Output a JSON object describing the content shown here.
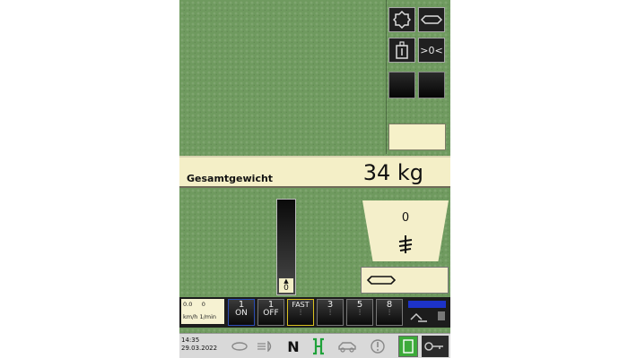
{
  "weight": {
    "label": "Gesamtgewicht",
    "value": "34 kg"
  },
  "gauge": {
    "value": "0"
  },
  "mode_panel": {
    "value": "0"
  },
  "readout": {
    "line1_a": "0.0",
    "line1_b": "0",
    "line2": "km/h 1/min"
  },
  "function_buttons": [
    {
      "label": "1",
      "sub": "ON",
      "edge": "blue"
    },
    {
      "label": "1",
      "sub": "OFF",
      "edge": "none"
    },
    {
      "label": "FAST",
      "sub": "",
      "edge": "yellow"
    },
    {
      "label": "3",
      "sub": "",
      "edge": "none"
    },
    {
      "label": "5",
      "sub": "",
      "edge": "none"
    },
    {
      "label": "8",
      "sub": "",
      "edge": "none"
    }
  ],
  "status_bar": {
    "time": "14:35",
    "date": "29.03.2022",
    "gear_label": "N"
  },
  "top_right": {
    "distance_label": ">0<"
  },
  "colors": {
    "panel_bg": "#6f9a5f",
    "beige": "#f4efca",
    "status_green": "#3daa3a",
    "accent_blue": "#1d33c9"
  }
}
